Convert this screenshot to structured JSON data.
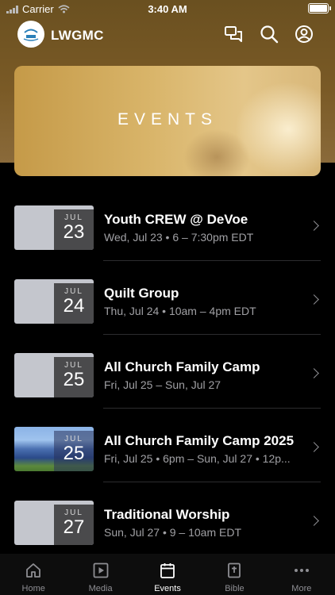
{
  "status_bar": {
    "carrier": "Carrier",
    "time": "3:40 AM"
  },
  "header": {
    "title": "LWGMC",
    "icons": [
      "chat-icon",
      "search-icon",
      "account-icon"
    ]
  },
  "hero": {
    "title": "EVENTS"
  },
  "events": [
    {
      "month": "JUL",
      "day": "23",
      "title": "Youth CREW @ DeVoe",
      "subtitle": "Wed, Jul 23 • 6 – 7:30pm EDT"
    },
    {
      "month": "JUL",
      "day": "24",
      "title": "Quilt Group",
      "subtitle": "Thu, Jul 24 • 10am – 4pm EDT"
    },
    {
      "month": "JUL",
      "day": "25",
      "title": "All Church Family Camp",
      "subtitle": "Fri, Jul 25 – Sun, Jul 27"
    },
    {
      "month": "JUL",
      "day": "25",
      "title": "All Church Family Camp 2025",
      "subtitle": "Fri, Jul 25 • 6pm – Sun, Jul 27 • 12p..."
    },
    {
      "month": "JUL",
      "day": "27",
      "title": "Traditional Worship",
      "subtitle": "Sun, Jul 27 • 9 – 10am EDT"
    }
  ],
  "tabs": [
    {
      "label": "Home",
      "icon": "home-icon",
      "active": false
    },
    {
      "label": "Media",
      "icon": "media-icon",
      "active": false
    },
    {
      "label": "Events",
      "icon": "calendar-icon",
      "active": true
    },
    {
      "label": "Bible",
      "icon": "bible-icon",
      "active": false
    },
    {
      "label": "More",
      "icon": "more-icon",
      "active": false
    }
  ],
  "colors": {
    "background": "#000000",
    "header_brown": "#7a5a26",
    "date_box": "#4a4a4c",
    "secondary_text": "#a0a0a4"
  }
}
